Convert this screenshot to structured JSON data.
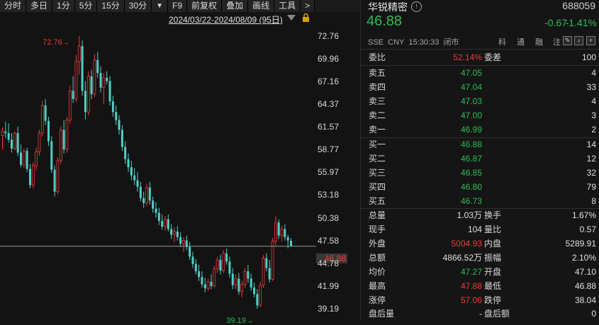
{
  "toolbar": {
    "items": [
      "分时",
      "多日",
      "1分",
      "5分",
      "15分",
      "30分",
      "▼",
      "F9",
      "前复权",
      "叠加",
      "画线",
      "工具",
      ">"
    ]
  },
  "chart": {
    "date_range": "2024/03/22-2024/08/09 (95日)",
    "y_labels": [
      "72.76",
      "69.96",
      "67.16",
      "64.37",
      "61.57",
      "58.77",
      "55.97",
      "53.18",
      "50.38",
      "47.58",
      "44.78",
      "41.99",
      "39.19"
    ],
    "current_price_tag": "46.88",
    "high_annotation": "72.76→",
    "low_annotation": "39.19→",
    "colors": {
      "up": "#ee3b3b",
      "down": "#2ebd55",
      "bg": "#131313"
    }
  },
  "chart_data": {
    "type": "candlestick",
    "ylim": [
      37.8,
      75.0
    ],
    "high": 72.76,
    "low": 39.19,
    "last": 46.88,
    "candles": [
      [
        60.5,
        61.5,
        58.8,
        61.0
      ],
      [
        61.0,
        62.2,
        60.2,
        60.8
      ],
      [
        60.8,
        62.0,
        59.6,
        60.0
      ],
      [
        60.0,
        60.8,
        58.4,
        58.9
      ],
      [
        58.9,
        61.0,
        58.7,
        60.8
      ],
      [
        60.8,
        61.6,
        58.0,
        58.4
      ],
      [
        58.4,
        59.4,
        56.6,
        56.9
      ],
      [
        56.9,
        58.9,
        56.5,
        58.6
      ],
      [
        58.6,
        59.0,
        56.0,
        56.4
      ],
      [
        56.4,
        57.0,
        54.0,
        54.4
      ],
      [
        54.4,
        57.2,
        54.0,
        56.8
      ],
      [
        56.8,
        59.0,
        56.2,
        58.5
      ],
      [
        58.5,
        61.2,
        58.0,
        60.8
      ],
      [
        60.8,
        64.8,
        60.4,
        64.2
      ],
      [
        64.2,
        65.0,
        61.8,
        62.3
      ],
      [
        62.3,
        62.8,
        59.2,
        59.8
      ],
      [
        59.8,
        60.4,
        55.9,
        56.3
      ],
      [
        56.3,
        56.8,
        53.0,
        53.6
      ],
      [
        53.6,
        57.8,
        53.3,
        57.4
      ],
      [
        57.4,
        61.6,
        57.0,
        61.2
      ],
      [
        61.2,
        62.4,
        58.3,
        58.8
      ],
      [
        58.8,
        62.8,
        58.4,
        62.4
      ],
      [
        62.4,
        66.6,
        62.0,
        66.0
      ],
      [
        66.0,
        67.8,
        64.5,
        65.0
      ],
      [
        65.0,
        70.4,
        64.6,
        69.6
      ],
      [
        69.6,
        72.76,
        68.0,
        71.5
      ],
      [
        71.5,
        72.2,
        65.4,
        66.0
      ],
      [
        66.0,
        67.2,
        62.5,
        63.4
      ],
      [
        63.4,
        68.4,
        63.0,
        67.8
      ],
      [
        67.8,
        68.6,
        65.0,
        65.6
      ],
      [
        65.6,
        70.5,
        65.2,
        69.8
      ],
      [
        69.8,
        70.8,
        67.6,
        68.2
      ],
      [
        68.2,
        69.0,
        65.8,
        66.4
      ],
      [
        66.4,
        68.2,
        64.4,
        67.6
      ],
      [
        67.6,
        68.4,
        66.8,
        67.2
      ],
      [
        67.2,
        67.8,
        64.2,
        64.7
      ],
      [
        64.7,
        65.4,
        62.8,
        63.4
      ],
      [
        63.4,
        64.2,
        61.8,
        62.4
      ],
      [
        62.4,
        63.0,
        60.6,
        61.2
      ],
      [
        61.2,
        61.8,
        58.6,
        59.1
      ],
      [
        59.1,
        59.8,
        57.0,
        57.6
      ],
      [
        57.6,
        58.3,
        56.0,
        56.6
      ],
      [
        56.6,
        57.4,
        55.0,
        55.6
      ],
      [
        55.6,
        56.5,
        54.4,
        55.0
      ],
      [
        55.0,
        56.0,
        53.6,
        54.2
      ],
      [
        54.2,
        54.8,
        52.4,
        52.8
      ],
      [
        52.8,
        53.6,
        51.6,
        52.2
      ],
      [
        52.2,
        54.6,
        51.8,
        54.1
      ],
      [
        54.1,
        54.8,
        52.0,
        52.5
      ],
      [
        52.5,
        53.0,
        51.0,
        51.5
      ],
      [
        51.5,
        52.3,
        50.4,
        51.0
      ],
      [
        51.0,
        51.6,
        49.5,
        50.0
      ],
      [
        50.0,
        50.8,
        48.9,
        49.3
      ],
      [
        49.3,
        50.6,
        48.8,
        50.2
      ],
      [
        50.2,
        50.8,
        48.7,
        49.0
      ],
      [
        49.0,
        49.6,
        47.8,
        48.3
      ],
      [
        48.3,
        49.2,
        47.4,
        48.7
      ],
      [
        48.7,
        49.4,
        47.6,
        48.0
      ],
      [
        48.0,
        48.6,
        46.8,
        47.2
      ],
      [
        47.2,
        48.0,
        46.2,
        47.6
      ],
      [
        47.6,
        48.2,
        46.4,
        46.8
      ],
      [
        46.8,
        47.4,
        45.2,
        45.6
      ],
      [
        45.6,
        46.2,
        44.2,
        44.7
      ],
      [
        44.7,
        45.3,
        43.4,
        43.8
      ],
      [
        43.8,
        44.6,
        42.6,
        43.1
      ],
      [
        43.1,
        43.8,
        41.8,
        42.2
      ],
      [
        42.2,
        43.0,
        41.2,
        41.7
      ],
      [
        41.7,
        42.9,
        41.4,
        42.5
      ],
      [
        42.5,
        43.4,
        41.6,
        42.0
      ],
      [
        42.0,
        44.5,
        41.8,
        44.1
      ],
      [
        44.1,
        45.6,
        43.6,
        45.2
      ],
      [
        45.2,
        45.8,
        43.4,
        43.9
      ],
      [
        43.9,
        46.4,
        43.6,
        46.0
      ],
      [
        46.0,
        46.6,
        44.6,
        45.0
      ],
      [
        45.0,
        45.6,
        43.0,
        43.5
      ],
      [
        43.5,
        44.2,
        41.6,
        42.1
      ],
      [
        42.1,
        43.4,
        41.6,
        42.9
      ],
      [
        42.9,
        43.6,
        40.9,
        41.3
      ],
      [
        41.3,
        42.6,
        40.6,
        42.2
      ],
      [
        42.2,
        44.2,
        41.8,
        43.8
      ],
      [
        43.8,
        44.6,
        42.4,
        42.9
      ],
      [
        42.9,
        43.5,
        41.4,
        41.8
      ],
      [
        41.8,
        42.4,
        40.6,
        41.0
      ],
      [
        41.0,
        41.6,
        39.19,
        39.6
      ],
      [
        39.6,
        42.5,
        39.4,
        42.1
      ],
      [
        42.1,
        45.8,
        41.8,
        45.4
      ],
      [
        45.4,
        46.0,
        43.8,
        44.2
      ],
      [
        44.2,
        45.2,
        42.4,
        42.8
      ],
      [
        42.8,
        47.9,
        42.6,
        47.5
      ],
      [
        47.5,
        50.6,
        47.0,
        49.8
      ],
      [
        49.8,
        50.2,
        47.8,
        48.2
      ],
      [
        48.2,
        49.4,
        47.5,
        49.0
      ],
      [
        49.0,
        49.6,
        47.6,
        48.0
      ],
      [
        48.0,
        48.3,
        46.6,
        47.6
      ],
      [
        47.55,
        47.88,
        46.88,
        46.88
      ]
    ]
  },
  "quote": {
    "name": "华锐精密",
    "code": "688059",
    "price": "46.88",
    "change": "-0.67",
    "change_pct": "-1.41%",
    "market": "SSE",
    "currency": "CNY",
    "time": "15:30:33",
    "status": "闭市",
    "flags": [
      "科",
      "通",
      "融",
      "注"
    ]
  },
  "order_book": {
    "weibi_label": "委比",
    "weibi_value": "52.14%",
    "weicha_label": "委差",
    "weicha_value": "100",
    "asks": [
      {
        "label": "卖五",
        "price": "47.05",
        "vol": "4"
      },
      {
        "label": "卖四",
        "price": "47.04",
        "vol": "33"
      },
      {
        "label": "卖三",
        "price": "47.03",
        "vol": "4"
      },
      {
        "label": "卖二",
        "price": "47.00",
        "vol": "3"
      },
      {
        "label": "卖一",
        "price": "46.99",
        "vol": "2"
      }
    ],
    "bids": [
      {
        "label": "买一",
        "price": "46.88",
        "vol": "14"
      },
      {
        "label": "买二",
        "price": "46.87",
        "vol": "12"
      },
      {
        "label": "买三",
        "price": "46.85",
        "vol": "32"
      },
      {
        "label": "买四",
        "price": "46.80",
        "vol": "79"
      },
      {
        "label": "买五",
        "price": "46.73",
        "vol": "8"
      }
    ]
  },
  "stats": [
    {
      "l1": "总量",
      "v1": "1.03万",
      "l2": "换手",
      "v2": "1.67%"
    },
    {
      "l1": "现手",
      "v1": "104",
      "l2": "量比",
      "v2": "0.57"
    },
    {
      "l1": "外盘",
      "v1": "5004.93",
      "l2": "内盘",
      "v2": "5289.91"
    },
    {
      "l1": "总额",
      "v1": "4866.52万",
      "l2": "振幅",
      "v2": "2.10%"
    },
    {
      "l1": "均价",
      "v1": "47.27",
      "l2": "开盘",
      "v2": "47.10"
    },
    {
      "l1": "最高",
      "v1": "47.88",
      "l2": "最低",
      "v2": "46.88"
    },
    {
      "l1": "涨停",
      "v1": "57.06",
      "l2": "跌停",
      "v2": "38.04"
    },
    {
      "l1": "盘后量",
      "v1": "-",
      "l2": "盘后额",
      "v2": "0"
    }
  ]
}
